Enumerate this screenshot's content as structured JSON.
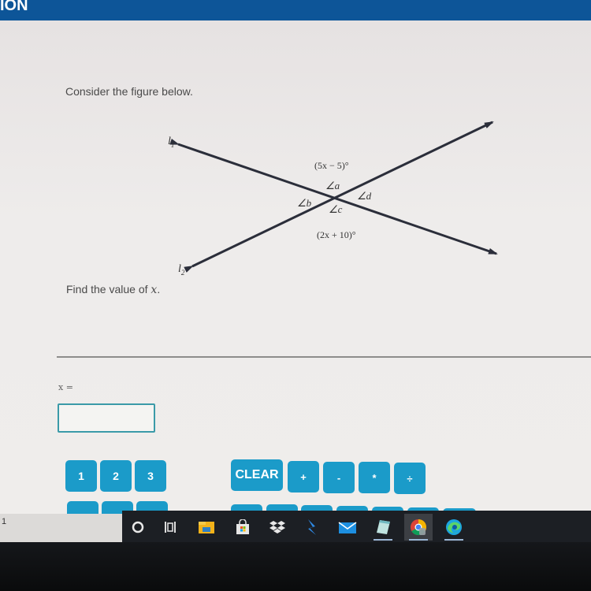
{
  "header": {
    "title": "ION"
  },
  "question": {
    "prompt": "Consider the figure below.",
    "find_text": "Find the value of ",
    "find_var": "x",
    "find_end": "."
  },
  "figure": {
    "line1_label": "l",
    "line1_sub": "1",
    "line2_label": "l",
    "line2_sub": "2",
    "top_expression": "(5x − 5)°",
    "bottom_expression": "(2x + 10)°",
    "angle_a": "∠a",
    "angle_b": "∠b",
    "angle_c": "∠c",
    "angle_d": "∠d"
  },
  "answer": {
    "variable_label": "x =",
    "value": "",
    "placeholder": ""
  },
  "keypad": {
    "keys": [
      "1",
      "2",
      "3"
    ],
    "clear": "CLEAR",
    "operators": [
      "+",
      "-",
      "*",
      "÷"
    ]
  },
  "taskbar": {
    "left_text": "1",
    "icons": [
      "search",
      "task-view",
      "file-explorer",
      "microsoft-store",
      "dropbox",
      "power-automate",
      "mail",
      "notepad",
      "chrome",
      "edge"
    ],
    "active": [
      "notepad",
      "chrome",
      "edge"
    ]
  }
}
